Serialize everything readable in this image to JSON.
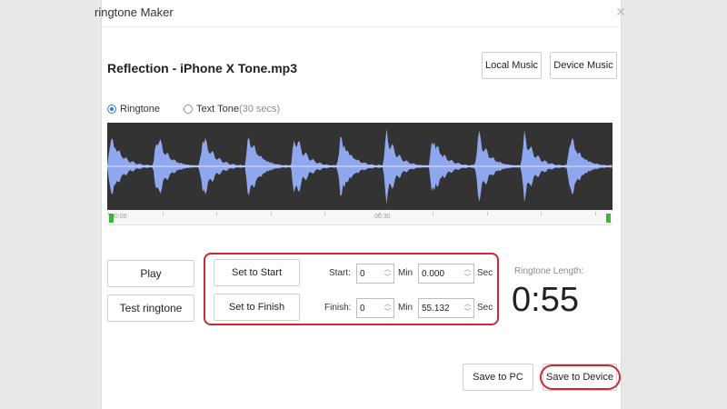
{
  "window": {
    "title": "ringtone Maker"
  },
  "file": {
    "name": "Reflection - iPhone X Tone.mp3"
  },
  "source_buttons": {
    "local": "Local Music",
    "device": "Device Music"
  },
  "tone_type": {
    "ringtone": "Ringtone",
    "text_tone": "Text Tone",
    "text_tone_hint": "(30 secs)",
    "selected": "Ringtone"
  },
  "timeline": {
    "start_label": "00:00",
    "mid_label": "00:30"
  },
  "controls": {
    "play": "Play",
    "test": "Test ringtone",
    "set_start": "Set to Start",
    "set_finish": "Set to Finish",
    "start_label": "Start:",
    "finish_label": "Finish:",
    "min_unit": "Min",
    "sec_unit": "Sec",
    "start_min": "0",
    "start_sec": "0.000",
    "finish_min": "0",
    "finish_sec": "55.132"
  },
  "length": {
    "label": "Ringtone Length:",
    "value": "0:55"
  },
  "save_buttons": {
    "pc": "Save to PC",
    "device": "Save to Device"
  },
  "colors": {
    "accent": "#2b78d8",
    "highlight": "#c92a36",
    "waveform_bg": "#333333",
    "wave": "#8fa7ee"
  }
}
